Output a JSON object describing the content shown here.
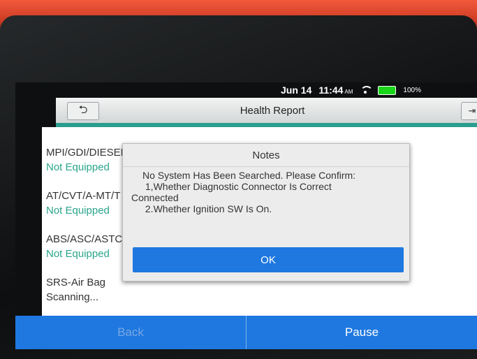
{
  "status": {
    "date": "Jun 14",
    "time": "11:44",
    "meridiem": "AM",
    "battery": "100%"
  },
  "header": {
    "title": "Health Report",
    "back_icon": "back-arrow-icon",
    "exit_icon": "exit-icon"
  },
  "systems": [
    {
      "name": "MPI/GDI/DIESEL",
      "status": "Not Equipped"
    },
    {
      "name": "AT/CVT/A-MT/T",
      "status": "Not Equipped"
    },
    {
      "name": "ABS/ASC/ASTC/",
      "status": "Not Equipped"
    },
    {
      "name": "SRS-Air Bag",
      "status": "Scanning..."
    }
  ],
  "bottom": {
    "back_label": "Back",
    "pause_label": "Pause"
  },
  "dialog": {
    "title": "Notes",
    "lines": [
      "No System Has Been Searched. Please Confirm:",
      " 1,Whether Diagnostic Connector Is Correct",
      "Connected",
      " 2.Whether Ignition SW Is On."
    ],
    "ok_label": "OK"
  },
  "colors": {
    "accent": "#1e78e0",
    "status_green": "#2aa58c",
    "device_red": "#e84a30"
  }
}
